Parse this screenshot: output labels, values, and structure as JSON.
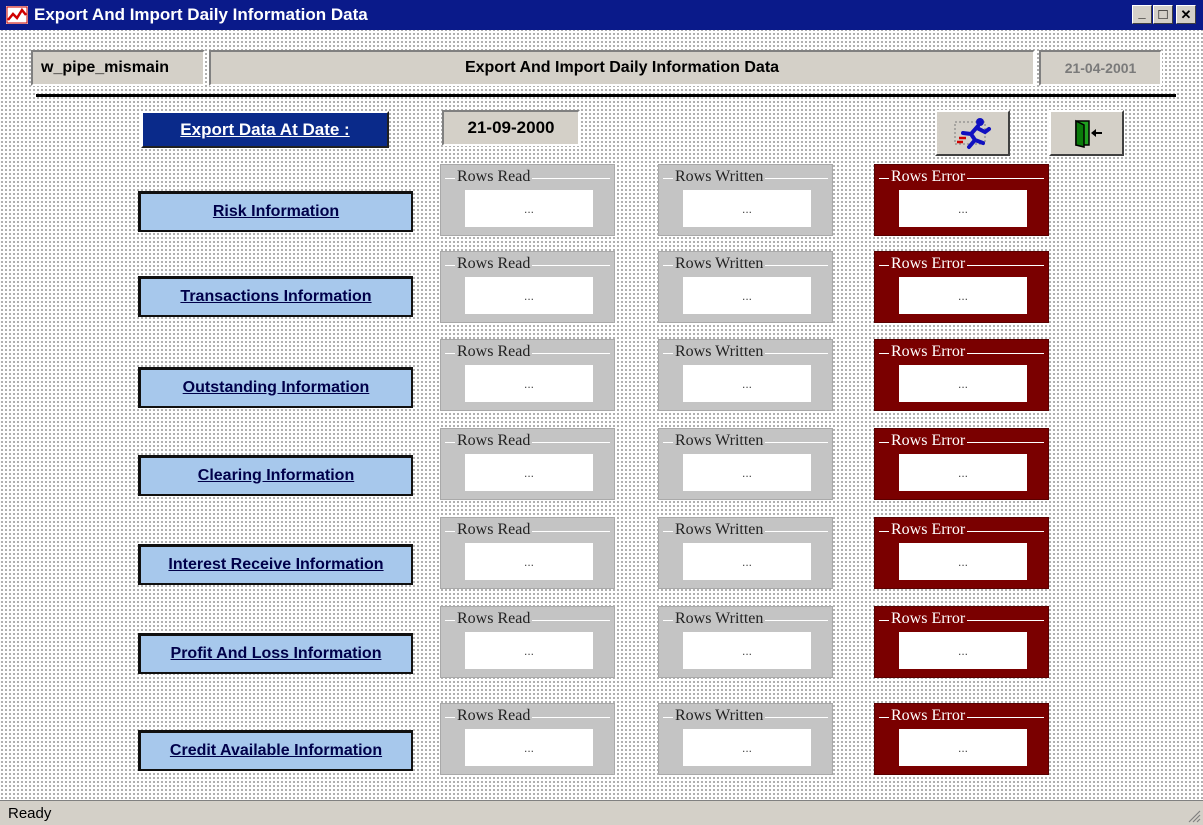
{
  "window": {
    "title": "Export And Import Daily Information Data",
    "controls": {
      "minimize": "_",
      "maximize": "□",
      "close": "✕"
    }
  },
  "header": {
    "window_name": "w_pipe_mismain",
    "title": "Export And Import Daily Information Data",
    "date": "21-04-2001"
  },
  "export": {
    "label": "Export Data At Date :",
    "date": "21-09-2000"
  },
  "toolbar": {
    "run_icon": "running-man-icon",
    "exit_icon": "exit-door-icon"
  },
  "group_labels": {
    "read": "Rows Read",
    "written": "Rows Written",
    "error": "Rows Error"
  },
  "rows": [
    {
      "label": "Risk Information",
      "read": "...",
      "written": "...",
      "error": "..."
    },
    {
      "label": "Transactions Information",
      "read": "...",
      "written": "...",
      "error": "..."
    },
    {
      "label": "Outstanding Information",
      "read": "...",
      "written": "...",
      "error": "..."
    },
    {
      "label": "Clearing Information",
      "read": "...",
      "written": "...",
      "error": "..."
    },
    {
      "label": "Interest Receive Information",
      "read": "...",
      "written": "...",
      "error": "..."
    },
    {
      "label": "Profit And Loss Information",
      "read": "...",
      "written": "...",
      "error": "..."
    },
    {
      "label": "Credit Available Information",
      "read": "...",
      "written": "...",
      "error": "..."
    }
  ],
  "status": {
    "text": "Ready"
  },
  "colors": {
    "titlebar": "#0a1a8a",
    "info_button": "#a7c8ec",
    "error_group": "#7a0000",
    "group_gray": "#c4c4c4"
  }
}
